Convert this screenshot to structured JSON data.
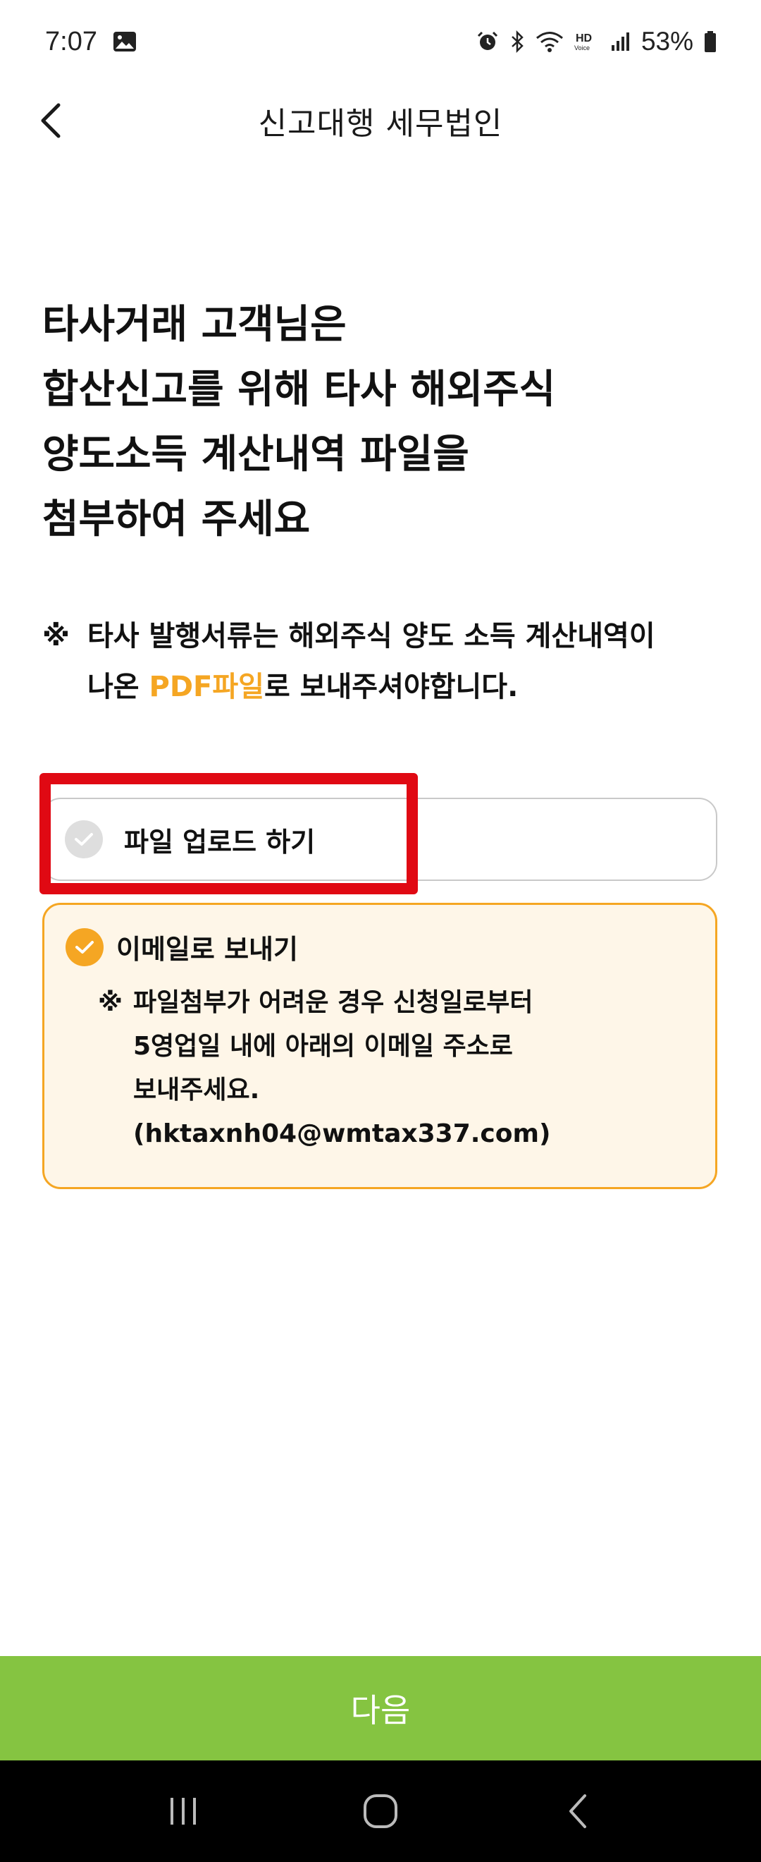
{
  "status_bar": {
    "time": "7:07",
    "battery": "53%",
    "icons": [
      "image-icon",
      "alarm-icon",
      "bluetooth-icon",
      "wifi-icon",
      "hd-voice-icon",
      "signal-icon",
      "battery-icon"
    ]
  },
  "header": {
    "title": "신고대행 세무법인",
    "back_icon": "chevron-left-icon"
  },
  "heading": {
    "lines": [
      "타사거래 고객님은",
      "합산신고를 위해 타사 해외주식",
      "양도소득 계산내역 파일을",
      "첨부하여 주세요"
    ]
  },
  "notice": {
    "mark": "※",
    "line1": "타사 발행서류는 해외주식 양도 소득 계산내역이",
    "line2_prefix": "나온 ",
    "line2_accent": "PDF파일",
    "line2_suffix": "로 보내주셔야합니다."
  },
  "options": {
    "upload": {
      "label": "파일 업로드 하기",
      "selected": false
    },
    "email": {
      "label": "이메일로 보내기",
      "selected": true,
      "note_mark": "※",
      "note_lines": [
        "파일첨부가 어려운 경우 신청일로부터",
        "5영업일 내에 아래의 이메일 주소로",
        "보내주세요.",
        "(hktaxnh04@wmtax337.com)"
      ]
    }
  },
  "next_button": {
    "label": "다음"
  },
  "colors": {
    "accent": "#f5a623",
    "primary_button": "#85c441",
    "highlight": "#e00913",
    "email_bg": "#fef6e8"
  }
}
